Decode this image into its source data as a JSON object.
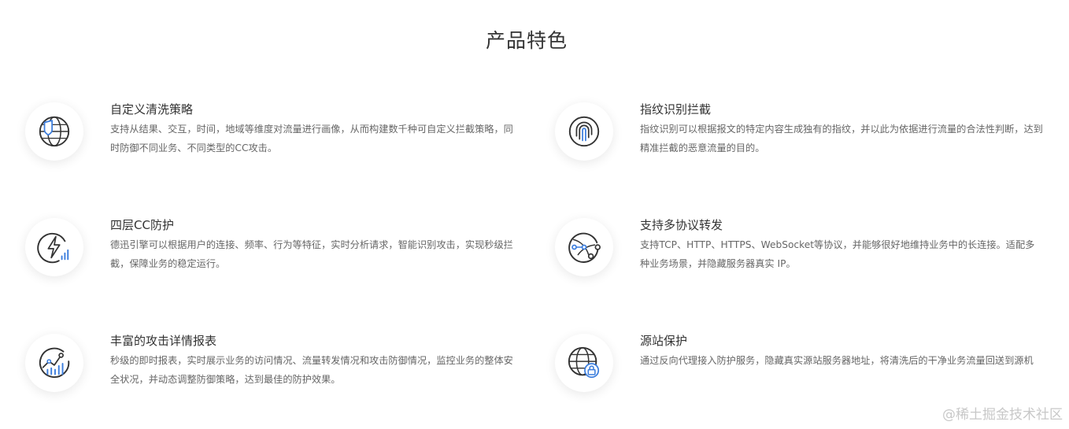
{
  "section": {
    "title": "产品特色"
  },
  "features": [
    {
      "title": "自定义清洗策略",
      "desc": "支持从结果、交互，时间，地域等维度对流量进行画像，从而构建数千种可自定义拦截策略，同时防御不同业务、不同类型的CC攻击。",
      "icon": "globe-shield-icon"
    },
    {
      "title": "指纹识别拦截",
      "desc": "指纹识别可以根据报文的特定内容生成独有的指纹，并以此为依据进行流量的合法性判断，达到精准拦截的恶意流量的目的。",
      "icon": "fingerprint-icon"
    },
    {
      "title": "四层CC防护",
      "desc": "德迅引擎可以根据用户的连接、频率、行为等特征，实时分析请求，智能识别攻击，实现秒级拦截，保障业务的稳定运行。",
      "icon": "lightning-chart-icon"
    },
    {
      "title": "支持多协议转发",
      "desc": "支持TCP、HTTP、HTTPS、WebSocket等协议，并能够很好地维持业务中的长连接。适配多种业务场景，并隐藏服务器真实 IP。",
      "icon": "network-protocol-icon"
    },
    {
      "title": "丰富的攻击详情报表",
      "desc": "秒级的即时报表，实时展示业务的访问情况、流量转发情况和攻击防御情况，监控业务的整体安全状况，并动态调整防御策略，达到最佳的防护效果。",
      "icon": "trend-chart-icon"
    },
    {
      "title": "源站保护",
      "desc": "通过反向代理接入防护服务，隐藏真实源站服务器地址，将清洗后的干净业务流量回送到源机",
      "icon": "globe-lock-icon"
    }
  ],
  "watermark": "@稀土掘金技术社区",
  "colors": {
    "accent": "#3b7ddd",
    "icon_stroke": "#333333",
    "title": "#333333",
    "desc": "#666666"
  }
}
